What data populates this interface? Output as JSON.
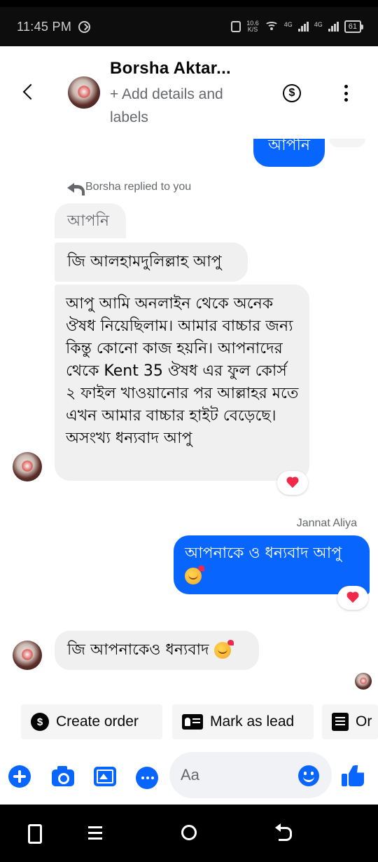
{
  "status_bar": {
    "time": "11:45 PM",
    "net_speed_value": "10.6",
    "net_speed_unit": "K/S",
    "signal1": "4G",
    "signal2": "4G",
    "battery": "61"
  },
  "header": {
    "contact_name": "Borsha Aktar...",
    "subtitle": "+ Add details and labels",
    "back_icon": "back-arrow-icon",
    "payment_icon": "dollar-icon",
    "more_icon": "more-vert-icon"
  },
  "conversation": {
    "top_partial_message": "আপনি",
    "reply_note": "Borsha replied to you",
    "quoted_text": "আপনি",
    "message_1": "জি আলহামদুলিল্লাহ আপু",
    "message_2": "আপু আমি অনলাইন থেকে অনেক ঔষধ নিয়েছিলাম। আমার বাচ্চার জন্য কিন্তু কোনো কাজ হয়নি। আপনাদের থেকে Kent 35 ঔষধ এর ফুল কোর্স ২ ফাইল খাওয়ানোর পর আল্লাহর মতে এখন আমার বাচ্চার হাইট বেড়েছে। অসংখ্য ধন্যবাদ আপু",
    "reaction_1": "heart-icon",
    "sender_name": "Jannat Aliya",
    "message_3": "আপনাকে ও ধন্যবাদ আপু",
    "reaction_2": "heart-icon",
    "message_4": "জি আপনাকেও ধন্যবাদ"
  },
  "quick_actions": [
    {
      "label": "Create order",
      "icon": "dollar-coin-icon"
    },
    {
      "label": "Mark as lead",
      "icon": "contact-card-icon"
    },
    {
      "label": "Or",
      "icon": "order-list-icon"
    }
  ],
  "composer": {
    "placeholder": "Aa",
    "value": ""
  },
  "colors": {
    "accent": "#0866ff",
    "incoming_bubble": "#f0f0f0",
    "muted_text": "#65676b",
    "reaction_heart": "#f02849"
  }
}
